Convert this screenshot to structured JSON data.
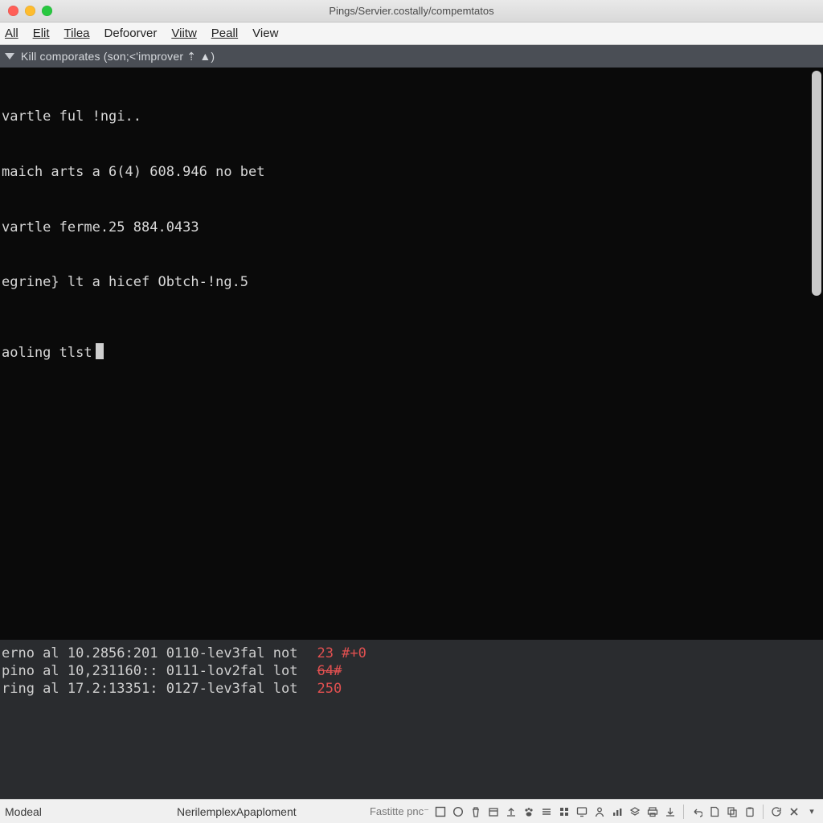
{
  "window": {
    "title": "Pings/Servier.costally/compemtatos"
  },
  "menu": {
    "items": [
      {
        "label": "All",
        "underline_index": 0
      },
      {
        "label": "Elit",
        "underline_index": 0
      },
      {
        "label": "Tilea",
        "underline_index": 0
      },
      {
        "label": "Defoorver",
        "underline_index": null
      },
      {
        "label": "Viitw",
        "underline_index": 0
      },
      {
        "label": "Peall",
        "underline_index": 0
      },
      {
        "label": "View",
        "underline_index": null
      }
    ]
  },
  "tab": {
    "label": "Kill comporates (son;<'improver ⇡ ▲)"
  },
  "terminal": {
    "lines": [
      "vartle ful !ngi..",
      "maich arts a 6(4) 608.946 no bet",
      "vartle ferme.25 884.0433",
      "egrine} lt a hicef Obtch-!ng.5"
    ],
    "prompt": "aoling tlst"
  },
  "log": {
    "rows": [
      {
        "lead": "erno al 10.2856:201 0110-lev3fal not",
        "num": "23 #+0",
        "strike": false
      },
      {
        "lead": "pino al 10,231160:: 0111-lov2fal lot",
        "num": "64#",
        "strike": true
      },
      {
        "lead": "ring al 17.2:13351: 0127-lev3fal lot",
        "num": "250",
        "strike": false
      }
    ]
  },
  "status": {
    "left": "Modeal",
    "center": "NerilemplexApaploment",
    "right_text": "Fastitte pnc⁻"
  },
  "icons": {
    "status_right": [
      "square-icon",
      "circle-icon",
      "trash-icon",
      "box-icon",
      "upload-icon",
      "paw-icon",
      "stack-icon",
      "grid-icon",
      "monitor-icon",
      "person-icon",
      "barchart-icon",
      "layers-icon",
      "printer-icon",
      "download-icon",
      "sep",
      "undo-icon",
      "page-icon",
      "copy-icon",
      "paste-icon",
      "sep",
      "refresh-icon",
      "close-icon",
      "more-icon"
    ]
  }
}
